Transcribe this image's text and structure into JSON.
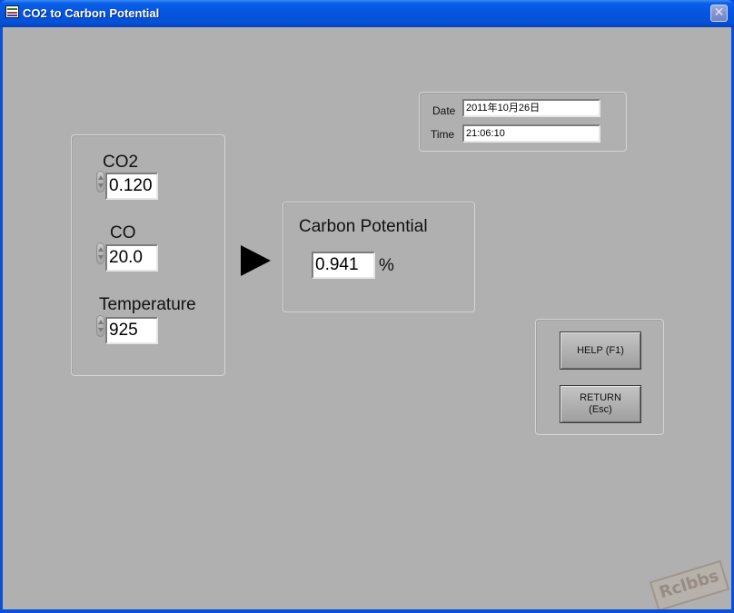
{
  "window": {
    "title": "CO2 to Carbon Potential",
    "close_symbol": "✕"
  },
  "icons": {
    "app": "labview-vi-icon",
    "close": "close-icon",
    "spinner": "increment-decrement-icon",
    "arrow": "right-arrow-icon"
  },
  "inputs": {
    "co2": {
      "label": "CO2",
      "value": "0.120"
    },
    "co": {
      "label": "CO",
      "value": "20.0"
    },
    "temperature": {
      "label": "Temperature",
      "value": "925"
    }
  },
  "output": {
    "label": "Carbon Potential",
    "value": "0.941",
    "unit": "%"
  },
  "datetime": {
    "date_label": "Date",
    "date_value": "2011年10月26日",
    "time_label": "Time",
    "time_value": "21:06:10"
  },
  "buttons": {
    "help_label": "HELP (F1)",
    "return_label": "RETURN\n(Esc)"
  },
  "watermark": {
    "text": "Rclbbs"
  },
  "colors": {
    "titlebar": "#0454e0",
    "panel_background": "#b0b0b0",
    "field_background": "#ffffff"
  }
}
